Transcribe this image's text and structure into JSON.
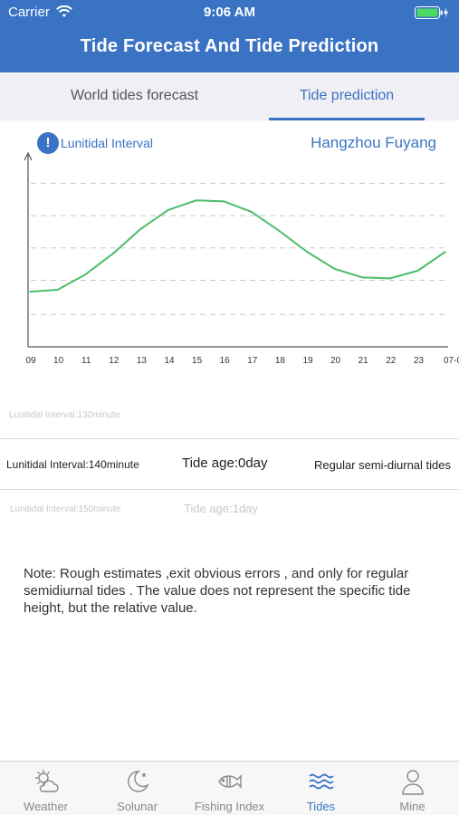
{
  "status": {
    "carrier": "Carrier",
    "time": "9:06 AM"
  },
  "header": {
    "title": "Tide Forecast And Tide Prediction"
  },
  "tabs": {
    "forecast": "World tides forecast",
    "prediction": "Tide prediction"
  },
  "chart_header": {
    "interval_label": "Lunitidal Interval",
    "location": "Hangzhou Fuyang"
  },
  "chart_data": {
    "type": "line",
    "x": [
      "09",
      "10",
      "11",
      "12",
      "13",
      "14",
      "15",
      "16",
      "17",
      "18",
      "19",
      "20",
      "21",
      "22",
      "23",
      "07-0"
    ],
    "series": [
      {
        "values": [
          0.29,
          0.3,
          0.38,
          0.49,
          0.62,
          0.72,
          0.77,
          0.765,
          0.71,
          0.61,
          0.5,
          0.41,
          0.365,
          0.36,
          0.4,
          0.5
        ]
      }
    ],
    "ylim": [
      0,
      1
    ],
    "grid": "horizontal dashed",
    "color": "#4cbd6b"
  },
  "wheel": {
    "row_top": {
      "interval": "Lunitidal Interval:130minute"
    },
    "row_selected": {
      "interval": "Lunitidal Interval:140minute",
      "age": "Tide age:0day",
      "type": "Regular semi-diurnal tides"
    },
    "row_bottom": {
      "interval": "Lunitidal Interval:150minute",
      "age": "Tide age:1day"
    }
  },
  "note": "Note: Rough estimates ,exit obvious errors , and only for regular semidiurnal tides . The  value does not represent the specific tide height, but the relative value.",
  "tabbar": {
    "items": [
      {
        "label": "Weather",
        "icon": "weather-icon"
      },
      {
        "label": "Solunar",
        "icon": "moon-icon"
      },
      {
        "label": "Fishing Index",
        "icon": "fish-icon"
      },
      {
        "label": "Tides",
        "icon": "waves-icon"
      },
      {
        "label": "Mine",
        "icon": "user-icon"
      }
    ],
    "active_index": 3
  },
  "colors": {
    "accent": "#3a73c4",
    "line": "#4cbd6b",
    "tab_bg": "#efeff4"
  }
}
